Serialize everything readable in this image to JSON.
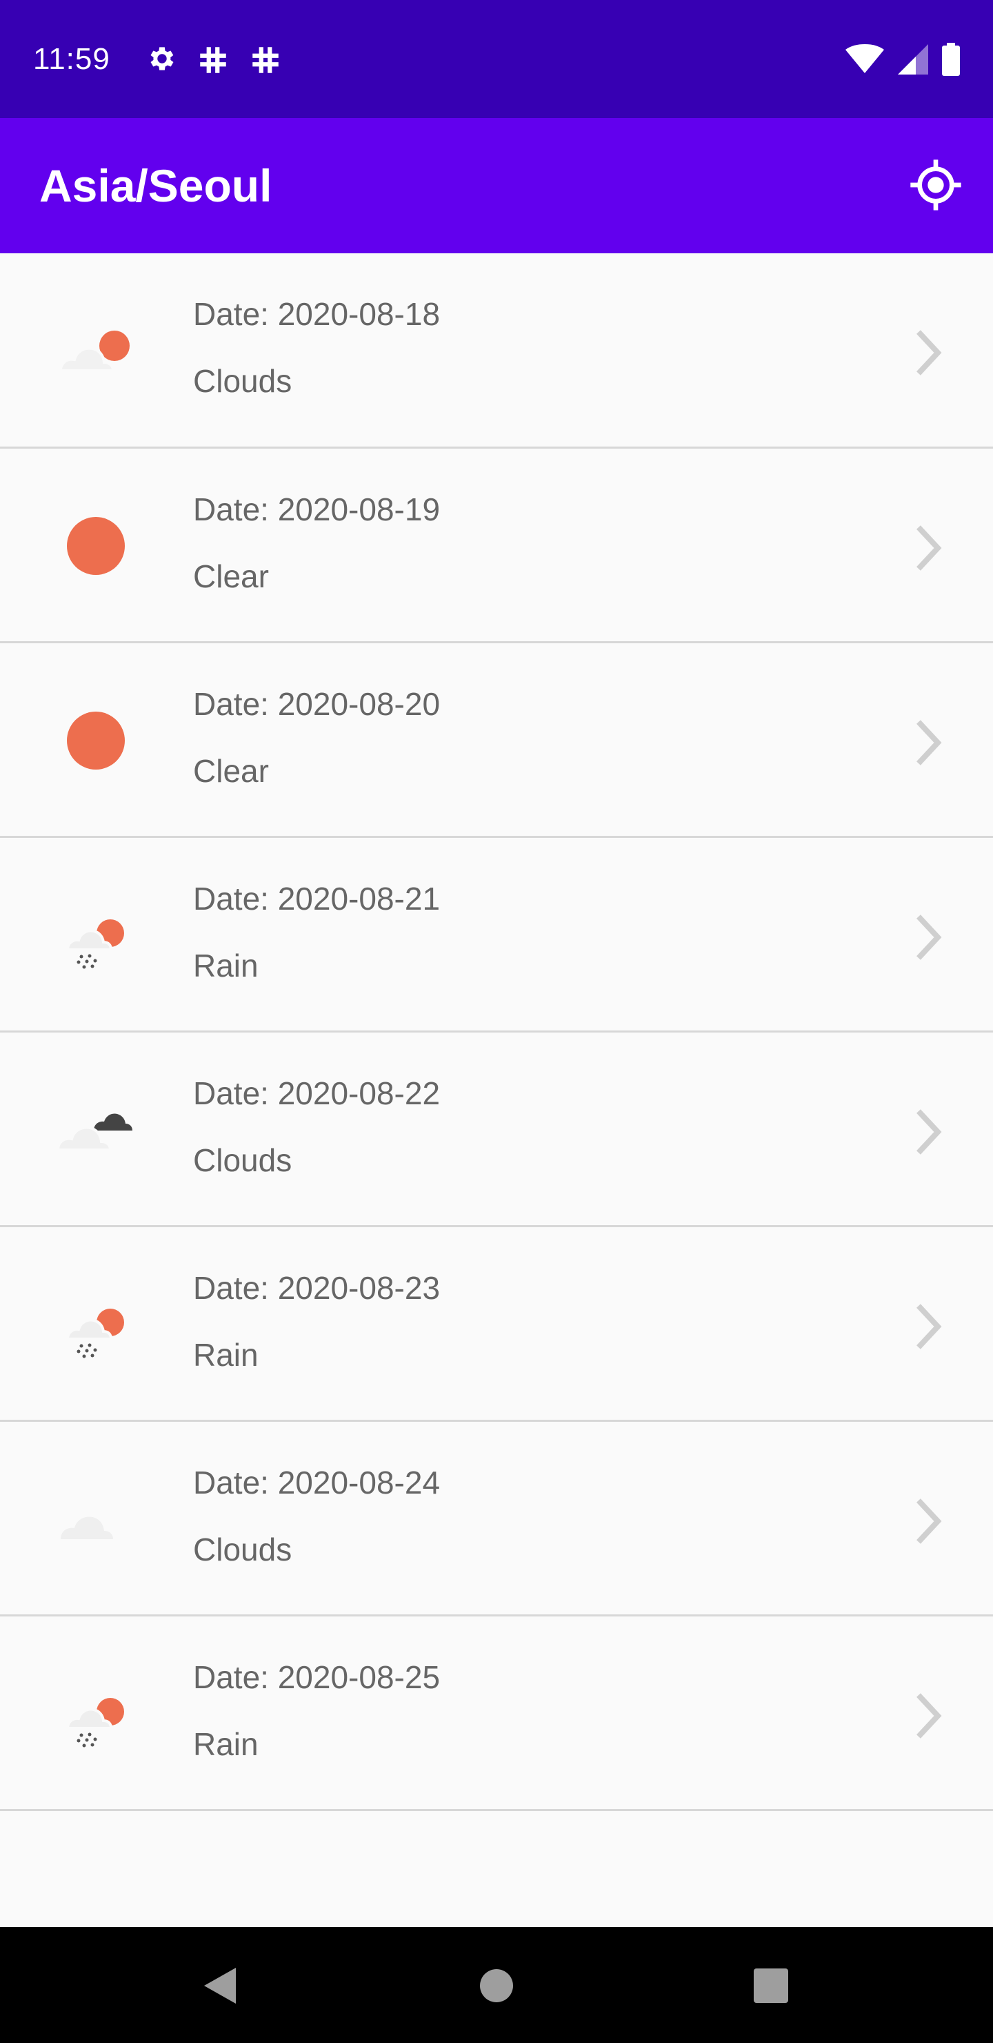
{
  "status_bar": {
    "time": "11:59",
    "icons_left": [
      "settings-icon",
      "hash-icon",
      "hash-icon"
    ],
    "icons_right": [
      "wifi-icon",
      "cell-signal-icon",
      "battery-icon"
    ]
  },
  "app_bar": {
    "title": "Asia/Seoul",
    "action_icon": "my-location-icon",
    "background": "#6200ee"
  },
  "forecast": [
    {
      "date": "Date: 2020-08-18",
      "description": "Clouds",
      "icon": "few-clouds-day-icon"
    },
    {
      "date": "Date: 2020-08-19",
      "description": "Clear",
      "icon": "clear-day-icon"
    },
    {
      "date": "Date: 2020-08-20",
      "description": "Clear",
      "icon": "clear-day-icon"
    },
    {
      "date": "Date: 2020-08-21",
      "description": "Rain",
      "icon": "rain-day-icon"
    },
    {
      "date": "Date: 2020-08-22",
      "description": "Clouds",
      "icon": "broken-clouds-icon"
    },
    {
      "date": "Date: 2020-08-23",
      "description": "Rain",
      "icon": "rain-day-icon"
    },
    {
      "date": "Date: 2020-08-24",
      "description": "Clouds",
      "icon": "scattered-clouds-icon"
    },
    {
      "date": "Date: 2020-08-25",
      "description": "Rain",
      "icon": "rain-day-icon"
    }
  ],
  "nav_bar": {
    "buttons": [
      "back-icon",
      "home-icon",
      "recents-icon"
    ]
  },
  "colors": {
    "status_bar": "#3700b3",
    "sun": "#ed6e4e",
    "text": "#666666"
  }
}
